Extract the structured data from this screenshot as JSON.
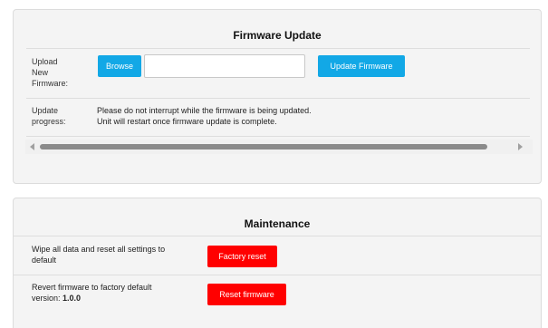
{
  "firmware_update": {
    "title": "Firmware Update",
    "upload_label": [
      "Upload",
      "New",
      "Firmware:"
    ],
    "browse_label": "Browse",
    "file_input_value": "",
    "update_button_label": "Update Firmware",
    "progress_label": [
      "Update",
      "progress:"
    ],
    "progress_lines": [
      "Please do not interrupt while the firmware is being updated.",
      "Unit will restart once firmware update is complete."
    ]
  },
  "maintenance": {
    "title": "Maintenance",
    "wipe_text": [
      "Wipe all data and reset all settings to",
      "default"
    ],
    "factory_reset_label": "Factory reset",
    "revert_text": [
      "Revert firmware to factory default",
      "version:"
    ],
    "factory_version": "1.0.0",
    "reset_firmware_label": "Reset firmware"
  },
  "colors": {
    "primary_button": "#12a8e6",
    "danger_button": "#ff0000",
    "panel_background": "#f4f4f4"
  }
}
